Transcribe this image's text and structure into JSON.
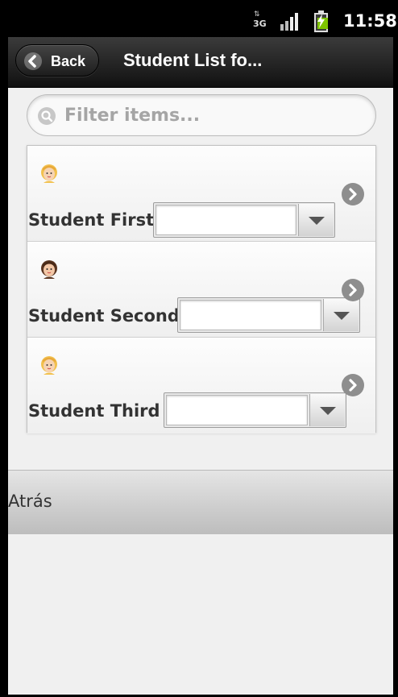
{
  "statusbar": {
    "network_label": "3G",
    "time": "11:58",
    "battery_color": "#7ec400"
  },
  "header": {
    "back_label": "Back",
    "title": "Student List fo..."
  },
  "search": {
    "placeholder": "Filter items...",
    "value": ""
  },
  "students": [
    {
      "name": "Student First",
      "selected_value": "",
      "avatar": "blonde-student-avatar-icon"
    },
    {
      "name": "Student Second",
      "selected_value": "",
      "avatar": "brunette-student-avatar-icon"
    },
    {
      "name": "Student Third",
      "selected_value": "",
      "avatar": "blonde-student-avatar-icon"
    }
  ],
  "footer": {
    "label": "Atrás"
  }
}
